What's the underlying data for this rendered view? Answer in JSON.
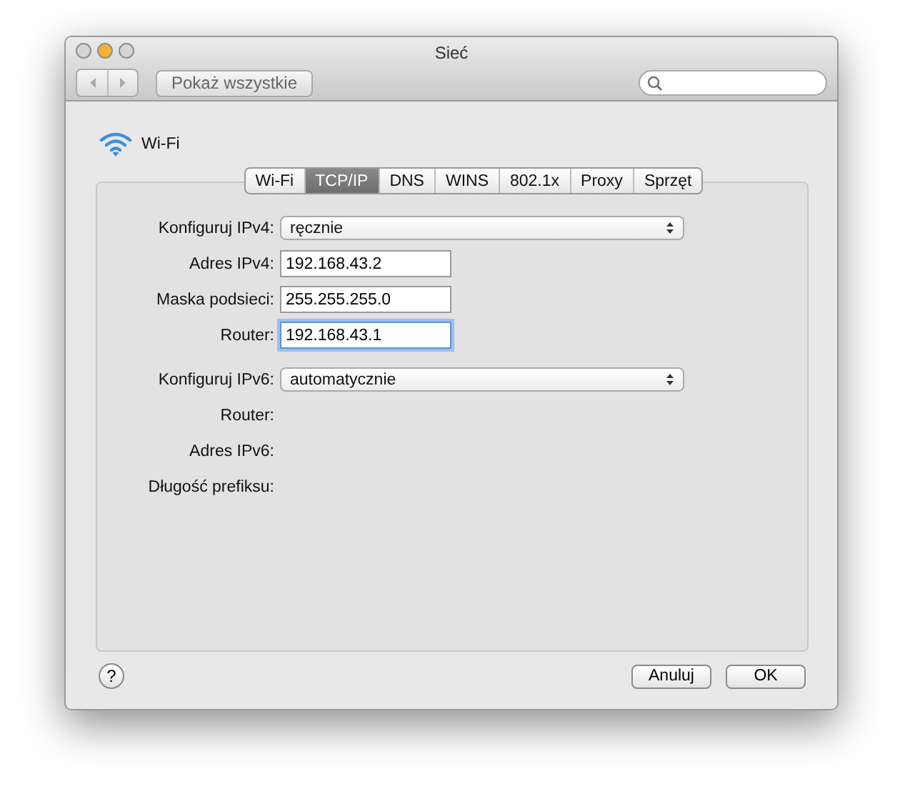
{
  "window": {
    "title": "Sieć"
  },
  "toolbar": {
    "show_all": "Pokaż wszystkie"
  },
  "sheet": {
    "service": "Wi-Fi",
    "tabs": [
      {
        "label": "Wi-Fi",
        "selected": false
      },
      {
        "label": "TCP/IP",
        "selected": true
      },
      {
        "label": "DNS",
        "selected": false
      },
      {
        "label": "WINS",
        "selected": false
      },
      {
        "label": "802.1x",
        "selected": false
      },
      {
        "label": "Proxy",
        "selected": false
      },
      {
        "label": "Sprzęt",
        "selected": false
      }
    ],
    "fields": [
      {
        "kind": "popup",
        "label": "Konfiguruj IPv4:",
        "value": "ręcznie"
      },
      {
        "kind": "text",
        "label": "Adres IPv4:",
        "value": "192.168.43.2",
        "focused": false
      },
      {
        "kind": "text",
        "label": "Maska podsieci:",
        "value": "255.255.255.0",
        "focused": false
      },
      {
        "kind": "text",
        "label": "Router:",
        "value": "192.168.43.1",
        "focused": true
      },
      {
        "kind": "popup",
        "label": "Konfiguruj IPv6:",
        "value": "automatycznie"
      },
      {
        "kind": "static",
        "label": "Router:"
      },
      {
        "kind": "static",
        "label": "Adres IPv6:"
      },
      {
        "kind": "static",
        "label": "Długość prefiksu:"
      }
    ],
    "help": "?",
    "buttons": [
      {
        "label": "Anuluj",
        "default": false
      },
      {
        "label": "OK",
        "default": false
      }
    ]
  }
}
